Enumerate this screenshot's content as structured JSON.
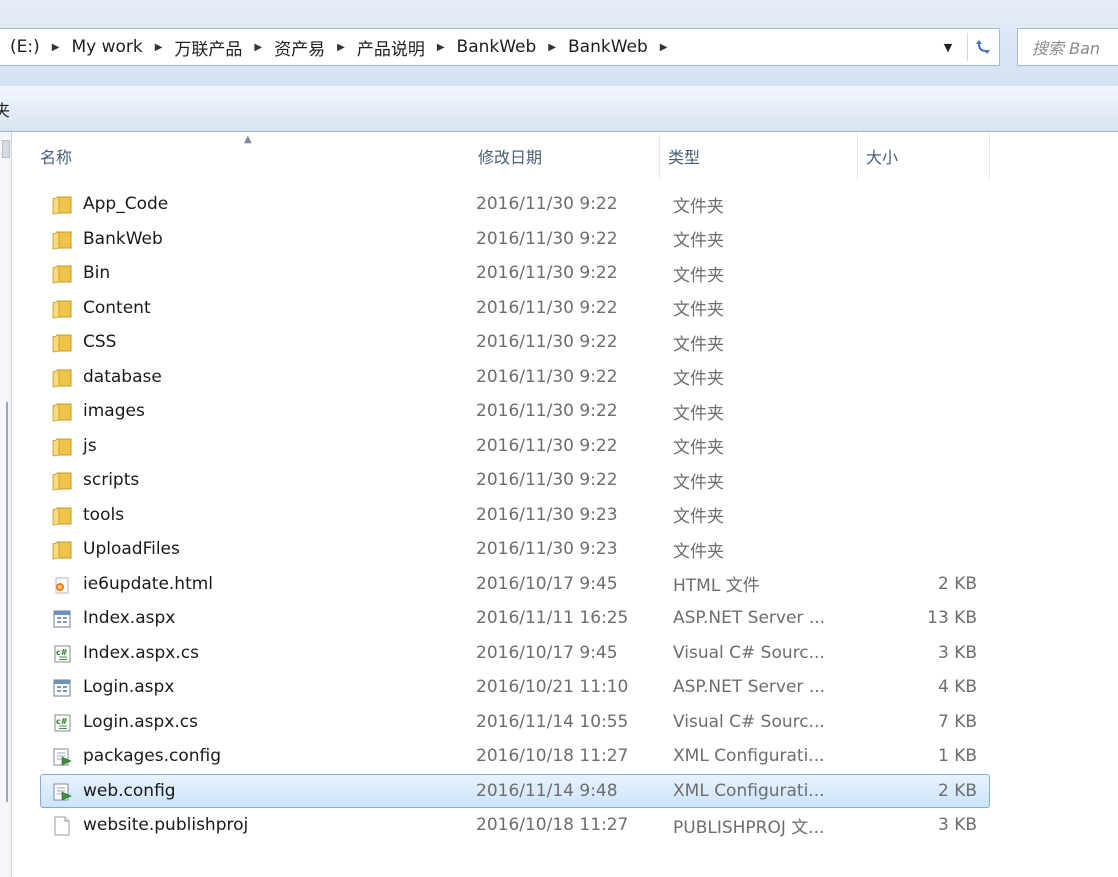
{
  "address_bar": {
    "crumbs": [
      "(E:)",
      "My work",
      "万联产品",
      "资产易",
      "产品说明",
      "BankWeb",
      "BankWeb"
    ],
    "search_placeholder": "搜索 Ban"
  },
  "toolbar": {
    "new_folder_label": "夹"
  },
  "columns": {
    "name": "名称",
    "date": "修改日期",
    "type": "类型",
    "size": "大小"
  },
  "files": [
    {
      "name": "App_Code",
      "date": "2016/11/30 9:22",
      "type": "文件夹",
      "size": "",
      "icon": "folder-icon"
    },
    {
      "name": "BankWeb",
      "date": "2016/11/30 9:22",
      "type": "文件夹",
      "size": "",
      "icon": "folder-icon"
    },
    {
      "name": "Bin",
      "date": "2016/11/30 9:22",
      "type": "文件夹",
      "size": "",
      "icon": "folder-icon"
    },
    {
      "name": "Content",
      "date": "2016/11/30 9:22",
      "type": "文件夹",
      "size": "",
      "icon": "folder-icon"
    },
    {
      "name": "CSS",
      "date": "2016/11/30 9:22",
      "type": "文件夹",
      "size": "",
      "icon": "folder-icon"
    },
    {
      "name": "database",
      "date": "2016/11/30 9:22",
      "type": "文件夹",
      "size": "",
      "icon": "folder-icon"
    },
    {
      "name": "images",
      "date": "2016/11/30 9:22",
      "type": "文件夹",
      "size": "",
      "icon": "folder-icon"
    },
    {
      "name": "js",
      "date": "2016/11/30 9:22",
      "type": "文件夹",
      "size": "",
      "icon": "folder-icon"
    },
    {
      "name": "scripts",
      "date": "2016/11/30 9:22",
      "type": "文件夹",
      "size": "",
      "icon": "folder-icon"
    },
    {
      "name": "tools",
      "date": "2016/11/30 9:23",
      "type": "文件夹",
      "size": "",
      "icon": "folder-icon"
    },
    {
      "name": "UploadFiles",
      "date": "2016/11/30 9:23",
      "type": "文件夹",
      "size": "",
      "icon": "folder-icon"
    },
    {
      "name": "ie6update.html",
      "date": "2016/10/17 9:45",
      "type": "HTML 文件",
      "size": "2 KB",
      "icon": "html-file-icon"
    },
    {
      "name": "Index.aspx",
      "date": "2016/11/11 16:25",
      "type": "ASP.NET Server ...",
      "size": "13 KB",
      "icon": "aspx-file-icon"
    },
    {
      "name": "Index.aspx.cs",
      "date": "2016/10/17 9:45",
      "type": "Visual C# Sourc...",
      "size": "3 KB",
      "icon": "csharp-file-icon"
    },
    {
      "name": "Login.aspx",
      "date": "2016/10/21 11:10",
      "type": "ASP.NET Server ...",
      "size": "4 KB",
      "icon": "aspx-file-icon"
    },
    {
      "name": "Login.aspx.cs",
      "date": "2016/11/14 10:55",
      "type": "Visual C# Sourc...",
      "size": "7 KB",
      "icon": "csharp-file-icon"
    },
    {
      "name": "packages.config",
      "date": "2016/10/18 11:27",
      "type": "XML Configurati...",
      "size": "1 KB",
      "icon": "config-file-icon"
    },
    {
      "name": "web.config",
      "date": "2016/11/14 9:48",
      "type": "XML Configurati...",
      "size": "2 KB",
      "icon": "config-file-icon",
      "selected": true
    },
    {
      "name": "website.publishproj",
      "date": "2016/10/18 11:27",
      "type": "PUBLISHPROJ 文...",
      "size": "3 KB",
      "icon": "blank-file-icon"
    }
  ],
  "colors": {
    "selection_bg": "#cde4fb",
    "selection_border": "#84acdd",
    "folder": "#f0c44c",
    "secondary_text": "#6d6d6d"
  }
}
